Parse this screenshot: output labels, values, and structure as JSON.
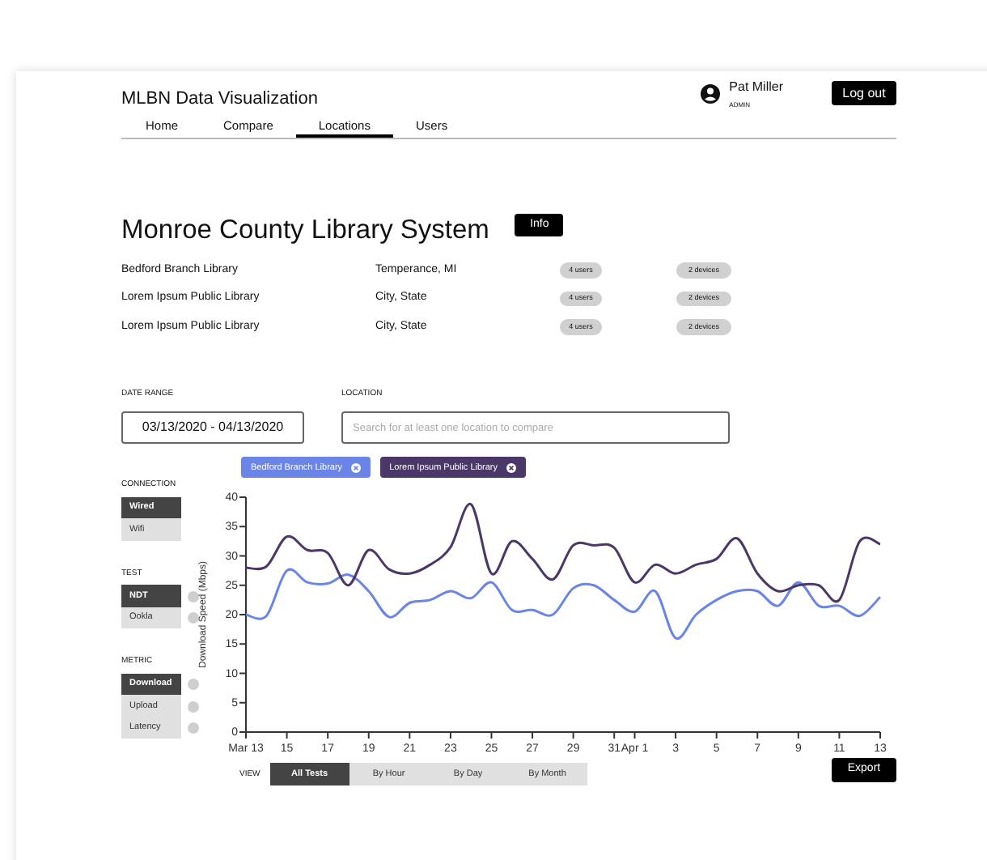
{
  "header": {
    "title": "MLBN Data Visualization",
    "user": {
      "name": "Pat Miller",
      "role": "ADMIN"
    },
    "logout": "Log out"
  },
  "nav": [
    {
      "label": "Home",
      "selected": false
    },
    {
      "label": "Compare",
      "selected": false
    },
    {
      "label": "Locations",
      "selected": true
    },
    {
      "label": "Users",
      "selected": false
    }
  ],
  "system": {
    "title": "Monroe County Library System",
    "info": "Info"
  },
  "libraries": [
    {
      "name": "Bedford Branch Library",
      "place": "Temperance, MI",
      "users": "4 users",
      "devices": "2 devices"
    },
    {
      "name": "Lorem Ipsum Public Library",
      "place": "City, State",
      "users": "4 users",
      "devices": "2 devices"
    },
    {
      "name": "Lorem Ipsum Public Library",
      "place": "City, State",
      "users": "4 users",
      "devices": "2 devices"
    }
  ],
  "date_range": {
    "label": "DATE RANGE",
    "value": "03/13/2020 - 04/13/2020"
  },
  "location": {
    "label": "LOCATION",
    "placeholder": "Search for at least one location to compare"
  },
  "chips": [
    {
      "label": "Bedford Branch Library",
      "color": "#6b84e8"
    },
    {
      "label": "Lorem Ipsum Public Library",
      "color": "#4b3869"
    }
  ],
  "filters": [
    {
      "label": "CONNECTION",
      "info": false,
      "items": [
        {
          "label": "Wired",
          "selected": true
        },
        {
          "label": "Wifi",
          "selected": false
        }
      ]
    },
    {
      "label": "TEST",
      "info": true,
      "items": [
        {
          "label": "NDT",
          "selected": true
        },
        {
          "label": "Ookla",
          "selected": false
        }
      ]
    },
    {
      "label": "METRIC",
      "info": true,
      "items": [
        {
          "label": "Download",
          "selected": true
        },
        {
          "label": "Upload",
          "selected": false
        },
        {
          "label": "Latency",
          "selected": false
        }
      ]
    }
  ],
  "chart_data": {
    "type": "line",
    "ylabel": "Download Speed (Mbps)",
    "ylim": [
      0,
      40
    ],
    "yticks": [
      0,
      5,
      10,
      15,
      20,
      25,
      30,
      35,
      40
    ],
    "categories": [
      "Mar 13",
      null,
      "15",
      null,
      "17",
      null,
      "19",
      null,
      "21",
      null,
      "23",
      null,
      "25",
      null,
      "27",
      null,
      "29",
      null,
      "31",
      "Apr 1",
      null,
      "3",
      null,
      "5",
      null,
      "7",
      null,
      "9",
      null,
      "11",
      null,
      "13"
    ],
    "series": [
      {
        "color": "#6b84e8",
        "values": [
          20,
          19.8,
          27.5,
          25.5,
          25.3,
          26.8,
          24,
          19.6,
          22,
          22.5,
          24,
          22.8,
          25.5,
          20.8,
          20.8,
          20,
          24.5,
          25,
          22.5,
          20.5,
          24,
          16,
          20,
          22.5,
          24,
          24,
          21.5,
          25.5,
          21.5,
          21.5,
          19.8,
          23
        ]
      },
      {
        "color": "#4b3869",
        "values": [
          28,
          28.2,
          33.3,
          31,
          30.5,
          25,
          31,
          27.7,
          27,
          28.5,
          31.5,
          38.8,
          27,
          32.5,
          29.5,
          26,
          31.8,
          31.8,
          31.4,
          25.5,
          28.5,
          27,
          28.5,
          29.5,
          33,
          27,
          24,
          25,
          25,
          22.5,
          32.5,
          32
        ]
      }
    ]
  },
  "view": {
    "label": "VIEW",
    "options": [
      {
        "label": "All Tests",
        "selected": true
      },
      {
        "label": "By Hour",
        "selected": false
      },
      {
        "label": "By Day",
        "selected": false
      },
      {
        "label": "By Month",
        "selected": false
      }
    ]
  },
  "export": "Export"
}
